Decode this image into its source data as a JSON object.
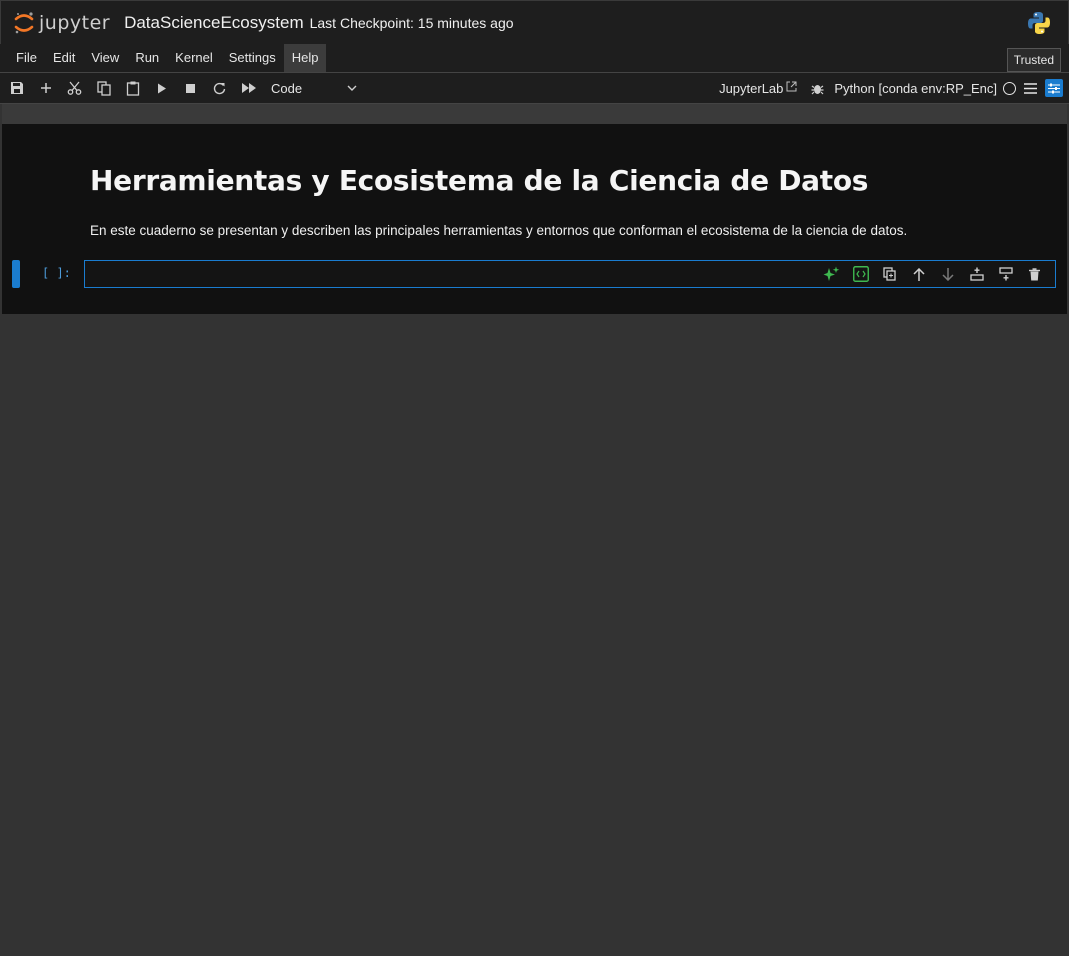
{
  "header": {
    "logo_text": "jupyter",
    "notebook_title": "DataScienceEcosystem",
    "checkpoint": "Last Checkpoint: 15 minutes ago"
  },
  "menu": {
    "items": [
      "File",
      "Edit",
      "View",
      "Run",
      "Kernel",
      "Settings",
      "Help"
    ],
    "active": "Help",
    "trusted": "Trusted"
  },
  "toolbar": {
    "icons": [
      "save-icon",
      "add-icon",
      "cut-icon",
      "copy-icon",
      "paste-icon",
      "run-icon",
      "stop-icon",
      "restart-icon",
      "fast-forward-icon"
    ],
    "cell_type": "Code",
    "jupyterlab_link": "JupyterLab",
    "kernel": "Python [conda env:RP_Enc]"
  },
  "notebook": {
    "heading": "Herramientas y Ecosistema de la Ciencia de Datos",
    "paragraph": "En este cuaderno se presentan y describen las principales herramientas y entornos que conforman el ecosistema de la ciencia de datos.",
    "prompt": "[ ]:"
  },
  "colors": {
    "accent": "#1a7ccf",
    "ai_green": "#3fb950",
    "background": "#333333",
    "notebook_bg": "#111111"
  }
}
